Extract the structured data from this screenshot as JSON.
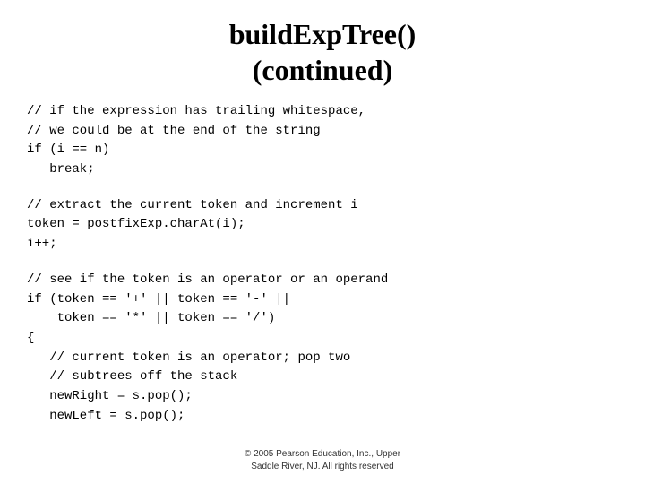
{
  "title": {
    "line1": "buildExpTree()",
    "line2": "(continued)"
  },
  "code": {
    "section1": [
      "// if the expression has trailing whitespace,",
      "// we could be at the end of the string",
      "if (i == n)",
      "   break;"
    ],
    "section2": [
      "// extract the current token and increment i",
      "token = postfixExp.charAt(i);",
      "i++;"
    ],
    "section3": [
      "// see if the token is an operator or an operand",
      "if (token == '+' || token == '-' ||",
      "    token == '*' || token == '/')",
      "{",
      "   // current token is an operator; pop two",
      "   // subtrees off the stack",
      "   newRight = s.pop();",
      "   newLeft = s.pop();"
    ]
  },
  "footer": {
    "line1": "© 2005 Pearson Education, Inc., Upper",
    "line2": "Saddle River, NJ.  All rights reserved"
  }
}
